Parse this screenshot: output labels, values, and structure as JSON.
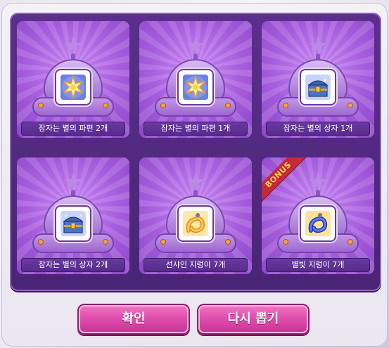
{
  "slots": [
    {
      "label": "잠자는 별의 파편 2개",
      "icon": "star-shard-icon",
      "bonus": ""
    },
    {
      "label": "잠자는 별의 파편 1개",
      "icon": "star-shard-icon",
      "bonus": ""
    },
    {
      "label": "잠자는 별의 상자 1개",
      "icon": "treasure-chest-icon",
      "bonus": ""
    },
    {
      "label": "잠자는 별의 상자 2개",
      "icon": "treasure-chest-icon",
      "bonus": ""
    },
    {
      "label": "선샤인 지렁이 7개",
      "icon": "golden-worm-icon",
      "bonus": ""
    },
    {
      "label": "별빛 지렁이 7개",
      "icon": "blue-worm-icon",
      "bonus": "BONUS"
    }
  ],
  "buttons": {
    "confirm": "확인",
    "redraw": "다시 뽑기"
  },
  "colors": {
    "panel": "#5b2f8c",
    "slot": "#a05ad8",
    "button": "#e14fae",
    "bonus_ribbon": "#c42a3a"
  }
}
